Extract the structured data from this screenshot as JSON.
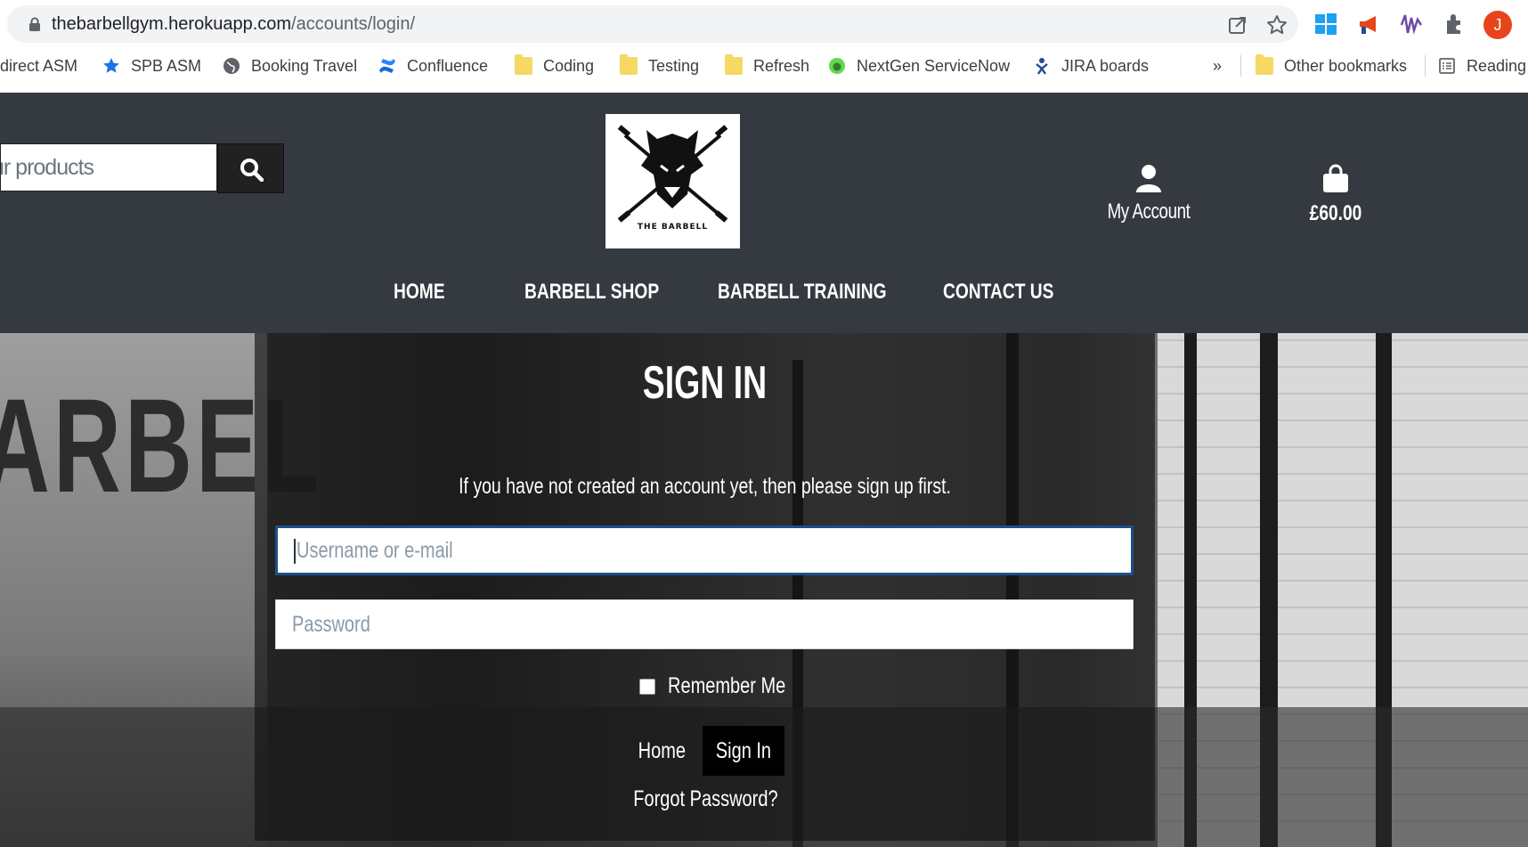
{
  "browser": {
    "url_host": "thebarbellgym.herokuapp.com",
    "url_path": "/accounts/login/",
    "profile_initial": "J",
    "bookmarks": [
      {
        "label": "direct ASM",
        "icon": "none"
      },
      {
        "label": "SPB ASM",
        "icon": "star-icon"
      },
      {
        "label": "Booking Travel",
        "icon": "globe-icon"
      },
      {
        "label": "Confluence",
        "icon": "confluence-icon"
      },
      {
        "label": "Coding",
        "icon": "folder-icon"
      },
      {
        "label": "Testing",
        "icon": "folder-icon"
      },
      {
        "label": "Refresh",
        "icon": "folder-icon"
      },
      {
        "label": "NextGen ServiceNow",
        "icon": "servicenow-icon"
      },
      {
        "label": "JIRA boards",
        "icon": "jira-icon"
      }
    ],
    "overflow_chevron": "»",
    "other_bookmarks": "Other bookmarks",
    "reading_list": "Reading"
  },
  "header": {
    "search_placeholder": "ur products",
    "logo_text": "THE BARBELL",
    "account_label": "My Account",
    "bag_total": "£60.00",
    "nav": [
      "HOME",
      "BARBELL SHOP",
      "BARBELL TRAINING",
      "CONTACT US"
    ]
  },
  "hero": {
    "wall_text": "ARBEL"
  },
  "login": {
    "title": "SIGN IN",
    "subtitle": "If you have not created an account yet, then please sign up first.",
    "username_placeholder": "Username or e-mail",
    "password_placeholder": "Password",
    "remember_label": "Remember Me",
    "home_button": "Home",
    "signin_button": "Sign In",
    "forgot_link": "Forgot Password?"
  },
  "colors": {
    "header_bg": "#343a40",
    "focus_border": "#1e4e8c",
    "avatar": "#e8441c"
  }
}
